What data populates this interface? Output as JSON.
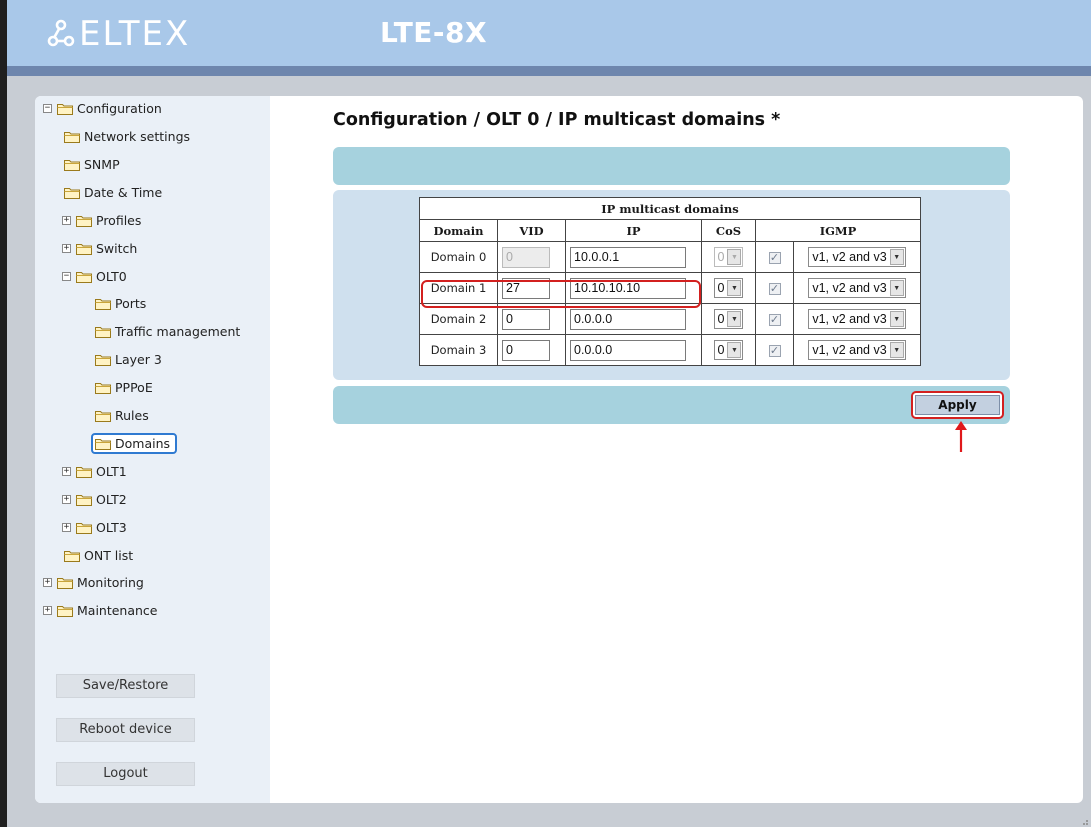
{
  "header": {
    "brand": "ELTEX",
    "model": "LTE-8X"
  },
  "sidebar": {
    "items": [
      {
        "label": "Configuration",
        "expander": "minus"
      },
      {
        "label": "Network settings"
      },
      {
        "label": "SNMP"
      },
      {
        "label": "Date & Time"
      },
      {
        "label": "Profiles",
        "expander": "plus"
      },
      {
        "label": "Switch",
        "expander": "plus"
      },
      {
        "label": "OLT0",
        "expander": "minus"
      },
      {
        "label": "Ports"
      },
      {
        "label": "Traffic management"
      },
      {
        "label": "Layer 3"
      },
      {
        "label": "PPPoE"
      },
      {
        "label": "Rules"
      },
      {
        "label": "Domains",
        "selected": true
      },
      {
        "label": "OLT1",
        "expander": "plus"
      },
      {
        "label": "OLT2",
        "expander": "plus"
      },
      {
        "label": "OLT3",
        "expander": "plus"
      },
      {
        "label": "ONT list"
      },
      {
        "label": "Monitoring",
        "expander": "plus"
      },
      {
        "label": "Maintenance",
        "expander": "plus"
      }
    ],
    "buttons": {
      "save_restore": "Save/Restore",
      "reboot": "Reboot device",
      "logout": "Logout"
    }
  },
  "page": {
    "title": "Configuration / OLT 0 / IP multicast domains *"
  },
  "table": {
    "caption": "IP multicast domains",
    "columns": {
      "domain": "Domain",
      "vid": "VID",
      "ip": "IP",
      "cos": "CoS",
      "igmp": "IGMP"
    },
    "rows": [
      {
        "domain": "Domain 0",
        "vid": "0",
        "ip": "10.0.0.1",
        "cos": "0",
        "igmp_enabled": true,
        "igmp": "v1, v2 and v3",
        "disabled": true
      },
      {
        "domain": "Domain 1",
        "vid": "27",
        "ip": "10.10.10.10",
        "cos": "0",
        "igmp_enabled": true,
        "igmp": "v1, v2 and v3",
        "disabled": false
      },
      {
        "domain": "Domain 2",
        "vid": "0",
        "ip": "0.0.0.0",
        "cos": "0",
        "igmp_enabled": true,
        "igmp": "v1, v2 and v3",
        "disabled": false
      },
      {
        "domain": "Domain 3",
        "vid": "0",
        "ip": "0.0.0.0",
        "cos": "0",
        "igmp_enabled": true,
        "igmp": "v1, v2 and v3",
        "disabled": false
      }
    ]
  },
  "actions": {
    "apply": "Apply"
  },
  "colors": {
    "header": "#a9c8e9",
    "band": "#a6d2de",
    "highlight": "#d3201f",
    "selected_border": "#2f7ad1"
  }
}
